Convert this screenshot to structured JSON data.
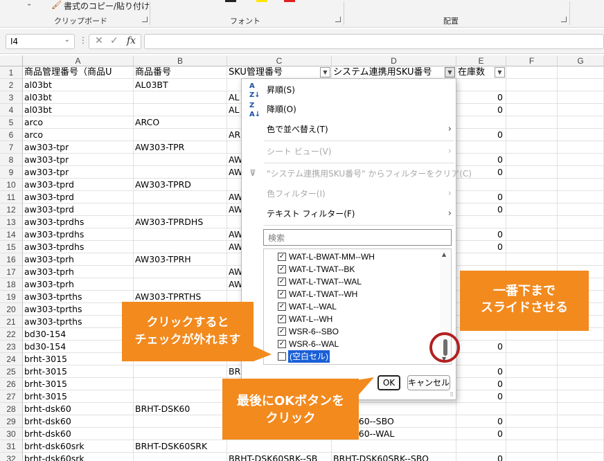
{
  "ribbon": {
    "format_painter_label": "書式のコピー/貼り付け",
    "groups": [
      {
        "label": "クリップボード"
      },
      {
        "label": "フォント"
      },
      {
        "label": "配置"
      }
    ]
  },
  "formula_bar": {
    "name_box": "I4",
    "fx_label": "fx",
    "formula": ""
  },
  "columns": [
    "A",
    "B",
    "C",
    "D",
    "E",
    "F",
    "G"
  ],
  "header_row": {
    "row": "1",
    "a": "商品管理番号（商品U",
    "b": "商品番号",
    "c": "SKU管理番号",
    "d": "システム連携用SKU番号",
    "e": "在庫数"
  },
  "rows": [
    {
      "n": "2",
      "a": "al03bt",
      "b": "AL03BT",
      "c": "",
      "d": "",
      "e": ""
    },
    {
      "n": "3",
      "a": "al03bt",
      "b": "",
      "c": "AL",
      "d": "",
      "e": "0"
    },
    {
      "n": "4",
      "a": "al03bt",
      "b": "",
      "c": "AL",
      "d": "",
      "e": "0"
    },
    {
      "n": "5",
      "a": "arco",
      "b": "ARCO",
      "c": "",
      "d": "",
      "e": ""
    },
    {
      "n": "6",
      "a": "arco",
      "b": "",
      "c": "AR",
      "d": "",
      "e": "0"
    },
    {
      "n": "7",
      "a": "aw303-tpr",
      "b": "AW303-TPR",
      "c": "",
      "d": "",
      "e": ""
    },
    {
      "n": "8",
      "a": "aw303-tpr",
      "b": "",
      "c": "AW",
      "d": "",
      "e": "0"
    },
    {
      "n": "9",
      "a": "aw303-tpr",
      "b": "",
      "c": "AW",
      "d": "",
      "e": "0"
    },
    {
      "n": "10",
      "a": "aw303-tprd",
      "b": "AW303-TPRD",
      "c": "",
      "d": "",
      "e": ""
    },
    {
      "n": "11",
      "a": "aw303-tprd",
      "b": "",
      "c": "AW",
      "d": "",
      "e": "0"
    },
    {
      "n": "12",
      "a": "aw303-tprd",
      "b": "",
      "c": "AW",
      "d": "",
      "e": "0"
    },
    {
      "n": "13",
      "a": "aw303-tprdhs",
      "b": "AW303-TPRDHS",
      "c": "",
      "d": "",
      "e": ""
    },
    {
      "n": "14",
      "a": "aw303-tprdhs",
      "b": "",
      "c": "AW",
      "d": "",
      "e": "0"
    },
    {
      "n": "15",
      "a": "aw303-tprdhs",
      "b": "",
      "c": "AW",
      "d": "",
      "e": "0"
    },
    {
      "n": "16",
      "a": "aw303-tprh",
      "b": "AW303-TPRH",
      "c": "",
      "d": "",
      "e": ""
    },
    {
      "n": "17",
      "a": "aw303-tprh",
      "b": "",
      "c": "AW",
      "d": "",
      "e": ""
    },
    {
      "n": "18",
      "a": "aw303-tprh",
      "b": "",
      "c": "AW",
      "d": "",
      "e": ""
    },
    {
      "n": "19",
      "a": "aw303-tprths",
      "b": "AW303-TPRTHS",
      "c": "",
      "d": "",
      "e": ""
    },
    {
      "n": "20",
      "a": "aw303-tprths",
      "b": "",
      "c": "AW",
      "d": "",
      "e": ""
    },
    {
      "n": "21",
      "a": "aw303-tprths",
      "b": "",
      "c": "AW",
      "d": "",
      "e": ""
    },
    {
      "n": "22",
      "a": "bd30-154",
      "b": "",
      "c": "",
      "d": "",
      "e": ""
    },
    {
      "n": "23",
      "a": "bd30-154",
      "b": "",
      "c": "",
      "d": "",
      "e": "0"
    },
    {
      "n": "24",
      "a": "brht-3015",
      "b": "",
      "c": "",
      "d": "",
      "e": ""
    },
    {
      "n": "25",
      "a": "brht-3015",
      "b": "",
      "c": "BR",
      "d": "",
      "e": "0"
    },
    {
      "n": "26",
      "a": "brht-3015",
      "b": "",
      "c": "",
      "d": "",
      "e": "0"
    },
    {
      "n": "27",
      "a": "brht-3015",
      "b": "",
      "c": "",
      "d": "",
      "e": "0"
    },
    {
      "n": "28",
      "a": "brht-dsk60",
      "b": "BRHT-DSK60",
      "c": "",
      "d": "",
      "e": ""
    },
    {
      "n": "29",
      "a": "brht-dsk60",
      "b": "",
      "c": "",
      "d": "T-DSK60--SBO",
      "e": "0"
    },
    {
      "n": "30",
      "a": "brht-dsk60",
      "b": "",
      "c": "",
      "d": "T-DSK60--WAL",
      "e": "0"
    },
    {
      "n": "31",
      "a": "brht-dsk60srk",
      "b": "BRHT-DSK60SRK",
      "c": "",
      "d": "",
      "e": ""
    },
    {
      "n": "32",
      "a": "brht-dsk60srk",
      "b": "",
      "c": "BRHT-DSK60SRK--SB",
      "d": "BRHT-DSK60SRK--SBO",
      "e": "0"
    }
  ],
  "filter_menu": {
    "sort_asc": "昇順(S)",
    "sort_desc": "降順(O)",
    "sort_by_color": "色で並べ替え(T)",
    "sheet_view": "シート ビュー(V)",
    "clear_filter": "\"システム連携用SKU番号\" からフィルターをクリア(C)",
    "color_filter": "色フィルター(I)",
    "text_filter": "テキスト フィルター(F)",
    "search_placeholder": "検索",
    "items": [
      {
        "label": "WAT-L-BWAT-MM--WH",
        "checked": true
      },
      {
        "label": "WAT-L-TWAT--BK",
        "checked": true
      },
      {
        "label": "WAT-L-TWAT--WAL",
        "checked": true
      },
      {
        "label": "WAT-L-TWAT--WH",
        "checked": true
      },
      {
        "label": "WAT-L--WAL",
        "checked": true
      },
      {
        "label": "WAT-L--WH",
        "checked": true
      },
      {
        "label": "WSR-6--SBO",
        "checked": true
      },
      {
        "label": "WSR-6--WAL",
        "checked": true
      },
      {
        "label": "(空白セル)",
        "checked": false
      }
    ],
    "ok": "OK",
    "cancel": "キャンセル"
  },
  "callouts": {
    "click_uncheck": [
      "クリックすると",
      "チェックが外れます"
    ],
    "scroll_bottom": [
      "一番下まで",
      "スライドさせる"
    ],
    "ok_click": [
      "最後にOKボタンを",
      "クリック"
    ]
  },
  "colors": {
    "callout": "#f28a1e",
    "highlight_ring": "#b32020",
    "selection": "#1a5fd6"
  }
}
